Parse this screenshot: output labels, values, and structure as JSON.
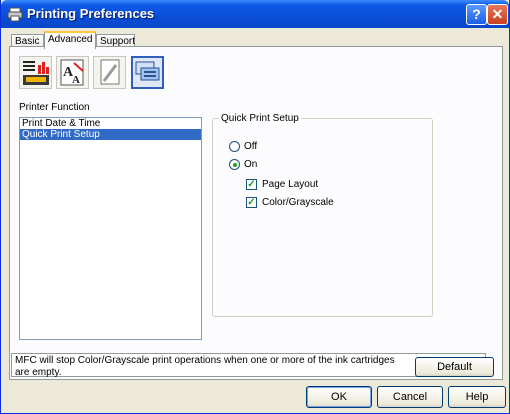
{
  "window": {
    "title": "Printing Preferences"
  },
  "titlebar": {
    "help_glyph": "?",
    "close_glyph": "✕"
  },
  "tabs": [
    {
      "label": "Basic",
      "active": false
    },
    {
      "label": "Advanced",
      "active": true
    },
    {
      "label": "Support",
      "active": false
    }
  ],
  "toolbar": {
    "icons": [
      {
        "name": "print-quality-icon",
        "selected": false
      },
      {
        "name": "watermark-icon",
        "selected": false
      },
      {
        "name": "copy-stamp-icon",
        "selected": false
      },
      {
        "name": "device-options-icon",
        "selected": true
      }
    ]
  },
  "printer_function": {
    "label": "Printer Function",
    "items": [
      {
        "label": "Print Date & Time",
        "selected": false
      },
      {
        "label": "Quick Print Setup",
        "selected": true
      }
    ]
  },
  "quick_print_setup": {
    "title": "Quick Print Setup",
    "off_label": "Off",
    "on_label": "On",
    "selected": "On",
    "page_layout_label": "Page Layout",
    "page_layout_checked": true,
    "color_label": "Color/Grayscale",
    "color_checked": true
  },
  "info": {
    "text": "MFC will stop Color/Grayscale print operations when one or more of the ink cartridges are empty."
  },
  "buttons": {
    "default": "Default",
    "ok": "OK",
    "cancel": "Cancel",
    "help": "Help"
  },
  "colors": {
    "titlebar": "#0a4fd8",
    "selection": "#316ac5",
    "dialog": "#ece9d8"
  }
}
